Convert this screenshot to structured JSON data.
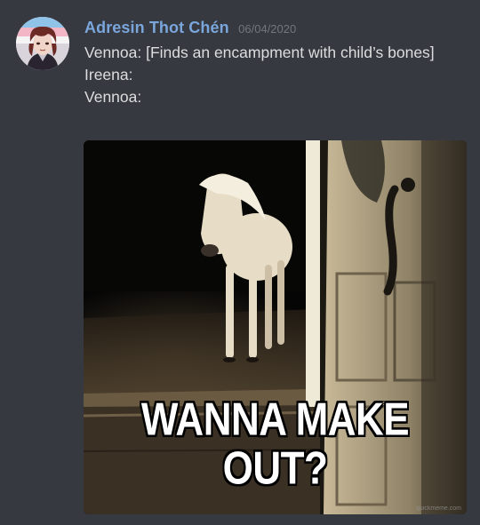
{
  "message": {
    "author": "Adresin Thot Chén",
    "timestamp": "06/04/2020",
    "lines": [
      "Vennoa: [Finds an encampment with child’s bones]",
      "Ireena:",
      "Vennoa:"
    ]
  },
  "attachment": {
    "caption_line1": "WANNA MAKE",
    "caption_line2": "OUT?",
    "watermark": "quickmeme.com"
  },
  "colors": {
    "background": "#36393f",
    "username": "#7aa6dc",
    "timestamp": "#72767d",
    "text": "#dcddde"
  }
}
